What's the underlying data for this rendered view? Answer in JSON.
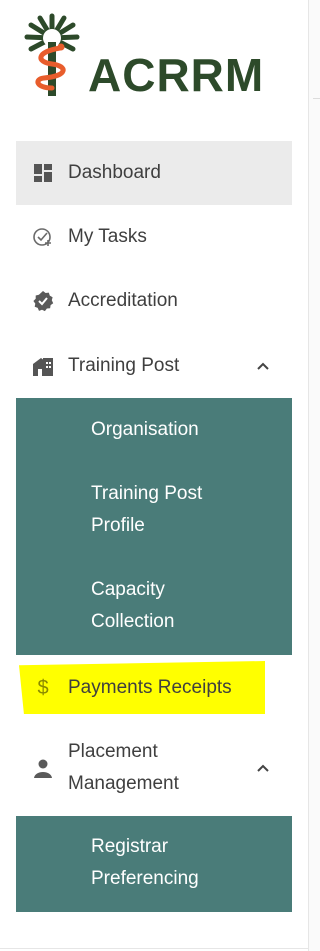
{
  "brand": {
    "name": "ACRRM"
  },
  "colors": {
    "brand_green": "#2d4a2a",
    "brand_orange": "#e85d2c",
    "submenu_bg": "#4a7c79",
    "active_bg": "#ebebeb",
    "highlight": "#ffff00"
  },
  "menu": {
    "dashboard": {
      "label": "Dashboard",
      "icon": "dashboard-icon"
    },
    "my_tasks": {
      "label": "My Tasks",
      "icon": "tasks-check-icon"
    },
    "accreditation": {
      "label": "Accreditation",
      "icon": "badge-check-icon"
    },
    "training_post": {
      "label": "Training Post",
      "icon": "building-icon",
      "expanded": true,
      "children": [
        {
          "label_lines": [
            "Organisation"
          ]
        },
        {
          "label_lines": [
            "Training Post",
            "Profile"
          ]
        },
        {
          "label_lines": [
            "Capacity",
            "Collection"
          ]
        }
      ]
    },
    "payments_receipts": {
      "label": "Payments Receipts",
      "icon": "dollar-icon"
    },
    "placement_management": {
      "label_lines": [
        "Placement",
        "Management"
      ],
      "icon": "person-icon",
      "expanded": true,
      "children": [
        {
          "label_lines": [
            "Registrar",
            "Preferencing"
          ]
        }
      ]
    }
  }
}
